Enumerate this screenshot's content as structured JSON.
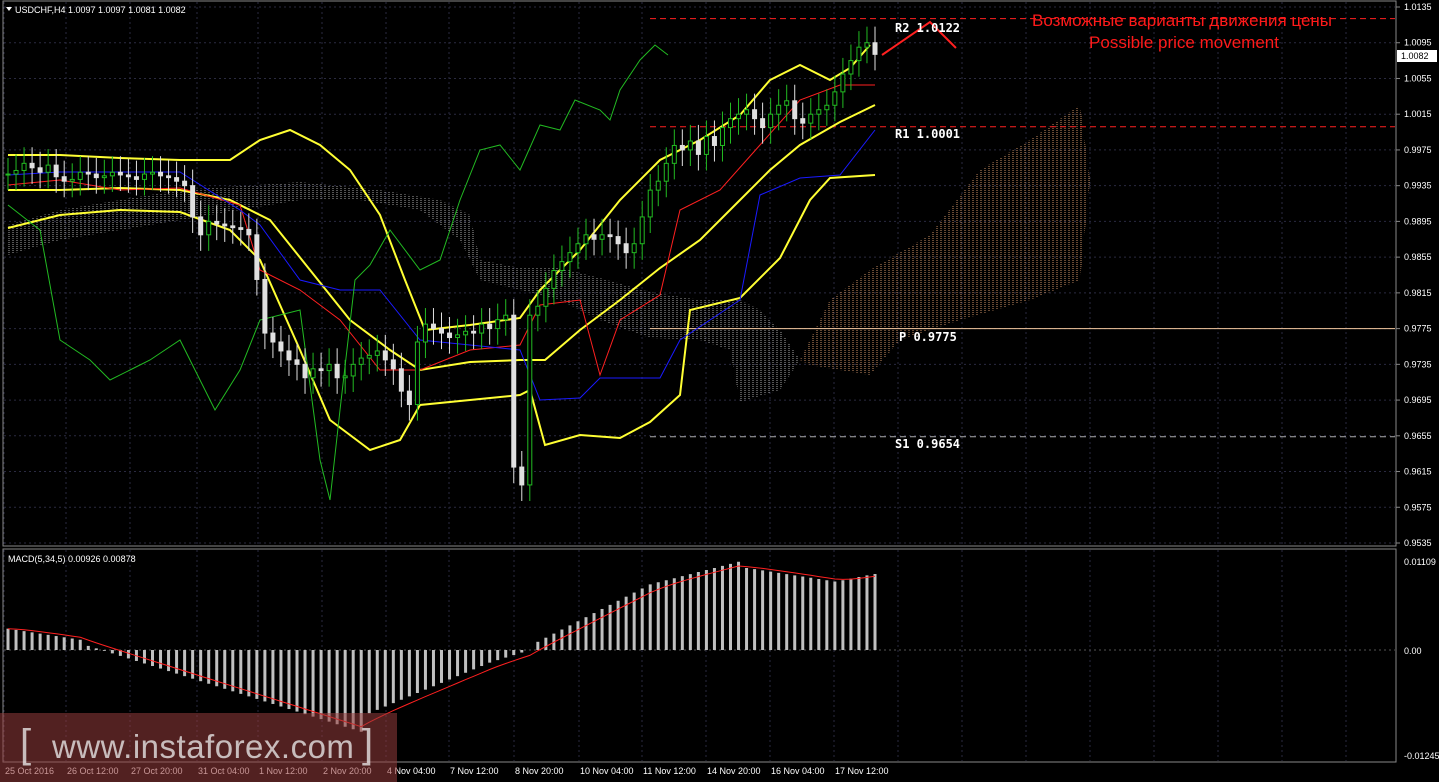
{
  "header": {
    "symbol_label": "USDCHF,H4  1.0097 1.0097 1.0081 1.0082",
    "macd_label": "MACD(5,34,5) 0.00926 0.00878"
  },
  "annotations": {
    "title_ru": "Возможные варианты движения цены",
    "title_en": "Possible price movement"
  },
  "levels": [
    {
      "name": "R2",
      "label": "R2 1.0122",
      "value": 1.0122,
      "color": "#ff2020",
      "style": "dashed"
    },
    {
      "name": "R1",
      "label": "R1 1.0001",
      "value": 1.0001,
      "color": "#ff2020",
      "style": "dashed"
    },
    {
      "name": "P",
      "label": "P 0.9775",
      "value": 0.9775,
      "color": "#f5c9a0",
      "style": "solid"
    },
    {
      "name": "S1",
      "label": "S1 0.9654",
      "value": 0.9654,
      "color": "#aaaaaa",
      "style": "dashed"
    }
  ],
  "price_axis": {
    "ticks": [
      "1.0135",
      "1.0095",
      "1.0055",
      "1.0015",
      "0.9975",
      "0.9935",
      "0.9895",
      "0.9855",
      "0.9815",
      "0.9775",
      "0.9735",
      "0.9695",
      "0.9655",
      "0.9615",
      "0.9575",
      "0.9535"
    ],
    "current_price": "1.0082"
  },
  "macd_axis": {
    "ticks": [
      "0.01109",
      "0.00",
      "-0.01245"
    ]
  },
  "time_axis": {
    "ticks": [
      "25 Oct 2016",
      "26 Oct 12:00",
      "27 Oct 20:00",
      "31 Oct 04:00",
      "1 Nov 12:00",
      "2 Nov 20:00",
      "4 Nov 04:00",
      "7 Nov 12:00",
      "8 Nov 20:00",
      "10 Nov 04:00",
      "11 Nov 12:00",
      "14 Nov 20:00",
      "16 Nov 04:00",
      "17 Nov 12:00"
    ]
  },
  "watermark": {
    "text": "www.instaforex.com",
    "left_bracket": "[",
    "right_bracket": "]"
  },
  "colors": {
    "background": "#000000",
    "grid": "#2a2a40",
    "bollinger": "#ffff33",
    "tenkan": "#ff2020",
    "kijun": "#1a1aff",
    "chikou": "#22bb22",
    "candle": "#e0e0e0",
    "candle_up": "#22bb22",
    "macd_hist": "#c0c0c0",
    "macd_signal": "#ff2020",
    "forecast": "#ff2020"
  },
  "chart_data": [
    {
      "type": "candlestick",
      "title": "USDCHF,H4",
      "ylim": [
        0.9535,
        1.0135
      ],
      "closes": [
        0.9948,
        0.9952,
        0.996,
        0.9955,
        0.995,
        0.9958,
        0.9945,
        0.994,
        0.9942,
        0.995,
        0.9948,
        0.9944,
        0.9946,
        0.995,
        0.9947,
        0.9945,
        0.9942,
        0.9948,
        0.995,
        0.9946,
        0.9944,
        0.994,
        0.9935,
        0.99,
        0.988,
        0.9895,
        0.9892,
        0.989,
        0.9888,
        0.9886,
        0.988,
        0.983,
        0.977,
        0.976,
        0.975,
        0.974,
        0.9735,
        0.972,
        0.973,
        0.9728,
        0.9735,
        0.972,
        0.9722,
        0.9735,
        0.9742,
        0.9745,
        0.975,
        0.974,
        0.973,
        0.9705,
        0.969,
        0.976,
        0.978,
        0.9775,
        0.977,
        0.9765,
        0.9768,
        0.9772,
        0.977,
        0.978,
        0.9775,
        0.9785,
        0.979,
        0.962,
        0.96,
        0.979,
        0.98,
        0.982,
        0.984,
        0.985,
        0.986,
        0.987,
        0.988,
        0.9875,
        0.988,
        0.9878,
        0.987,
        0.986,
        0.987,
        0.99,
        0.993,
        0.994,
        0.996,
        0.998,
        0.9975,
        0.9985,
        0.997,
        0.999,
        0.998,
        1.0,
        1.001,
        1.0015,
        1.002,
        1.001,
        1.0,
        1.0015,
        1.0025,
        1.003,
        1.001,
        1.0005,
        1.0015,
        1.002,
        1.0025,
        1.004,
        1.006,
        1.0075,
        1.009,
        1.0095,
        1.0082
      ],
      "bollinger": {
        "upper_end": 1.0095,
        "middle_end": 1.0038,
        "lower_end": 0.9945
      },
      "macd": {
        "ylim": [
          -0.01245,
          0.01109
        ],
        "hist_last": 0.00926,
        "signal_last": 0.00878
      }
    }
  ]
}
